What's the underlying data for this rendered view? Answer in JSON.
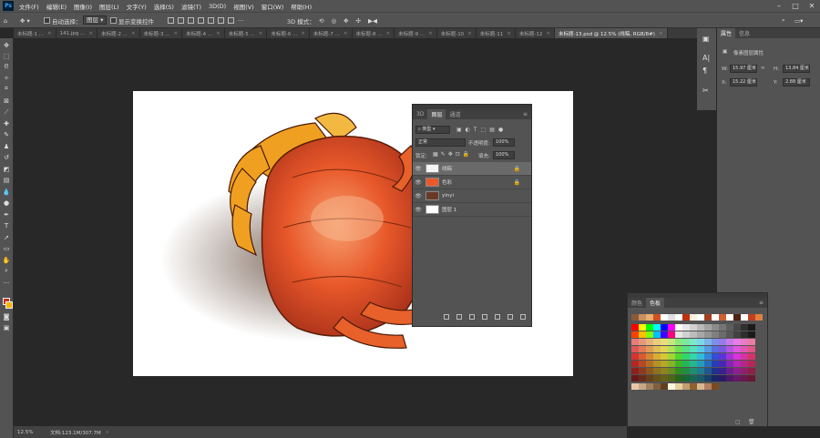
{
  "menu": {
    "logo": "Ps",
    "items": [
      "文件(F)",
      "编辑(E)",
      "图像(I)",
      "图层(L)",
      "文字(Y)",
      "选择(S)",
      "滤镜(T)",
      "3D(D)",
      "视图(V)",
      "窗口(W)",
      "帮助(H)"
    ]
  },
  "options": {
    "auto_select_label": "自动选择：",
    "auto_select_value": "图层",
    "show_transform_label": "显示变换控件",
    "mode_3d_label": "3D 模式："
  },
  "tabs": [
    "未标题-1 ...",
    "141.jpg ...",
    "未标题-2 ...",
    "未标题-3 ...",
    "未标题-4 ...",
    "未标题-5 ...",
    "未标题-6 ...",
    "未标题-7 ...",
    "未标题-8 ...",
    "未标题-9 ...",
    "未标题-10",
    "未标题-11",
    "未标题-12"
  ],
  "active_tab": "未标题-13.psd @ 12.5% (线稿, RGB/8#)",
  "status": {
    "zoom": "12.5%",
    "doc": "文档:123.1M/307.7M"
  },
  "properties": {
    "tab_properties": "属性",
    "tab_info": "信息",
    "section": "像素图层属性",
    "w_label": "W:",
    "w_value": "15.97 厘米",
    "h_label": "H:",
    "h_value": "13.84 厘米",
    "x_label": "X:",
    "x_value": "15.22 厘米",
    "y_label": "Y:",
    "y_value": "2.88 厘米"
  },
  "layers": {
    "tab_3d": "3D",
    "tab_layers": "图层",
    "tab_channels": "通道",
    "filter_kind": "类型",
    "blend_mode": "正常",
    "opacity_label": "不透明度:",
    "opacity_value": "100%",
    "lock_label": "锁定:",
    "fill_label": "填充:",
    "fill_value": "100%",
    "rows": [
      {
        "name": "线稿"
      },
      {
        "name": "色彩"
      },
      {
        "name": "yinyi"
      },
      {
        "name": "图层 1"
      }
    ]
  },
  "swatches": {
    "tab_color": "颜色",
    "tab_swatches": "色板"
  },
  "colors": {
    "ui_dark": "#535353",
    "workspace": "#282828",
    "fg": "#c8341e",
    "bg": "#f5b400"
  }
}
